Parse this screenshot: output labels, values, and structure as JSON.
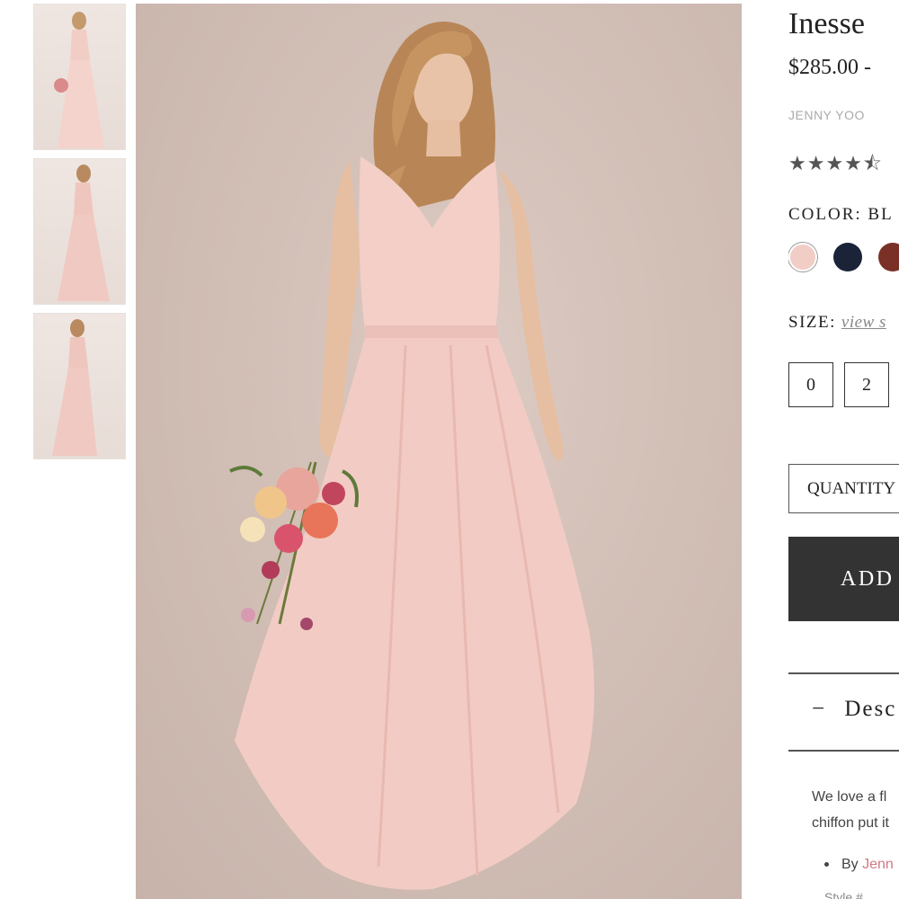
{
  "product": {
    "title": "Inesse",
    "price": "$285.00 -",
    "brand": "JENNY YOO",
    "rating_stars": "★★★★⯪"
  },
  "color": {
    "label": "COLOR: BL",
    "swatches": [
      {
        "name": "blush",
        "hex": "#f2cdc6"
      },
      {
        "name": "navy",
        "hex": "#1a2338"
      },
      {
        "name": "rust",
        "hex": "#7a3026"
      }
    ]
  },
  "size": {
    "label": "SIZE:",
    "link": "view s",
    "options": [
      "0",
      "2"
    ]
  },
  "quantity_label": "QUANTITY",
  "add_button": "ADD",
  "description": {
    "toggle": "−",
    "header": "Desc",
    "lines": [
      "We love a fl",
      "chiffon put it"
    ],
    "bullet_prefix": "By",
    "bullet_link": "Jenn",
    "bullet2": "Style #"
  },
  "colors": {
    "dress": "#f0c9c1",
    "background": "#d6c5bd",
    "button_dark": "#333333"
  }
}
